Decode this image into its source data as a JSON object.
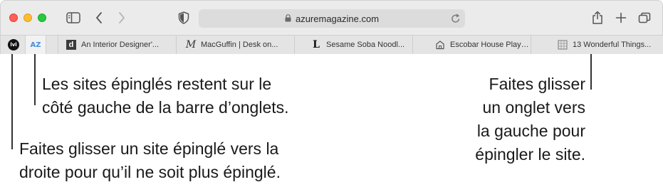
{
  "browser": {
    "address_bar": {
      "url": "azuremagazine.com"
    },
    "pinned_tabs": [
      {
        "label": "lvl"
      },
      {
        "label": "AZ"
      }
    ],
    "tabs": [
      {
        "favicon_label": "d",
        "title": "An Interior Designer'..."
      },
      {
        "favicon_label": "M",
        "title": "MacGuffin | Desk on..."
      },
      {
        "favicon_label": "L",
        "title": "Sesame Soba Noodl..."
      },
      {
        "favicon_label": "house",
        "title": "Escobar House Plays..."
      },
      {
        "favicon_label": "grid",
        "title": "13 Wonderful Things..."
      }
    ]
  },
  "callouts": {
    "pinned_sites": {
      "line1": "Les sites épinglés restent sur le",
      "line2": "côté gauche de la barre d’onglets."
    },
    "unpin": {
      "line1": "Faites glisser un site épinglé vers la",
      "line2": "droite pour qu’il ne soit plus épinglé."
    },
    "pin": {
      "line1": "Faites glisser",
      "line2": "un onglet vers",
      "line3": "la gauche pour",
      "line4": "épingler le site."
    }
  }
}
